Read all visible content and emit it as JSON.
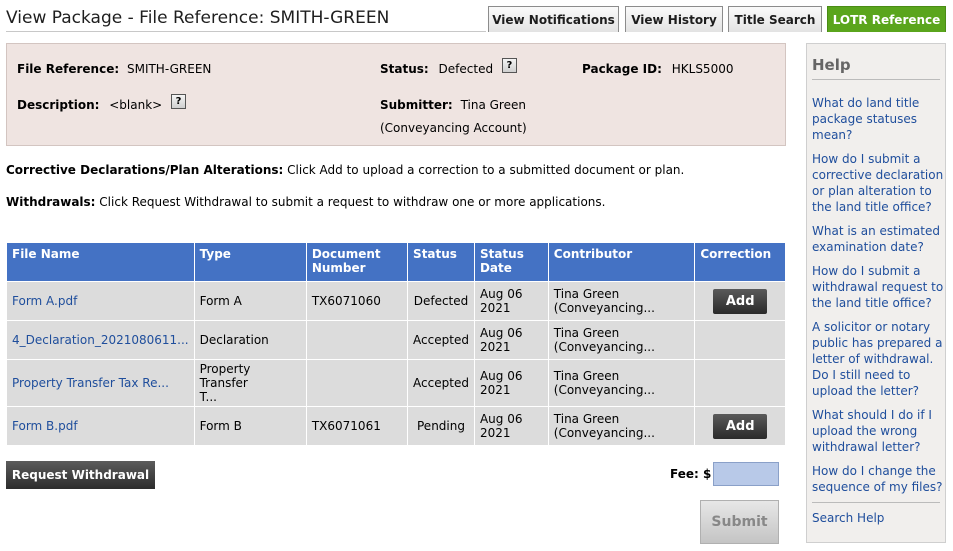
{
  "page": {
    "title": "View Package - File Reference: SMITH-GREEN"
  },
  "tabs": [
    {
      "label": "View Notifications"
    },
    {
      "label": "View History"
    },
    {
      "label": "Title Search"
    },
    {
      "label": "LOTR Reference"
    }
  ],
  "info": {
    "file_ref_label": "File Reference:",
    "file_ref_value": "SMITH-GREEN",
    "status_label": "Status:",
    "status_value": "Defected",
    "package_label": "Package ID:",
    "package_value": "HKLS5000",
    "description_label": "Description:",
    "description_value": "<blank>",
    "submitter_label": "Submitter:",
    "submitter_value": "Tina Green",
    "submitter_account": "(Conveyancing Account)",
    "help_glyph": "?"
  },
  "instructions": {
    "corrective_label": "Corrective Declarations/Plan Alterations:",
    "corrective_text": " Click Add to upload a correction to a submitted document or plan.",
    "withdrawals_label": "Withdrawals:",
    "withdrawals_text": " Click Request Withdrawal to submit a request to withdraw one or more applications."
  },
  "table": {
    "headers": [
      "File Name",
      "Type",
      "Document Number",
      "Status",
      "Status Date",
      "Contributor",
      "Correction"
    ],
    "headers_doc_line2": "Number",
    "rows": [
      {
        "file": "Form A.pdf",
        "type": "Form A",
        "type2": "",
        "doc": "TX6071060",
        "status": "Defected",
        "date": "Aug 06 2021",
        "contrib1": "Tina Green",
        "contrib2": "(Conveyancing...",
        "correction": "Add"
      },
      {
        "file": "4_Declaration_2021080611...",
        "type": "Declaration",
        "type2": "",
        "doc": "",
        "status": "Accepted",
        "date": "Aug 06 2021",
        "contrib1": "Tina Green",
        "contrib2": "(Conveyancing...",
        "correction": ""
      },
      {
        "file": "Property Transfer Tax Re...",
        "type": "Property Transfer",
        "type2": "T...",
        "doc": "",
        "status": "Accepted",
        "date": "Aug 06 2021",
        "contrib1": "Tina Green",
        "contrib2": "(Conveyancing...",
        "correction": ""
      },
      {
        "file": "Form B.pdf",
        "type": "Form B",
        "type2": "",
        "doc": "TX6071061",
        "status": "Pending",
        "date": "Aug 06 2021",
        "contrib1": "Tina Green",
        "contrib2": "(Conveyancing...",
        "correction": "Add"
      }
    ]
  },
  "actions": {
    "request_withdrawal": "Request Withdrawal",
    "fee_label": "Fee: $",
    "fee_value": "",
    "submit": "Submit"
  },
  "help": {
    "title": "Help",
    "links": [
      "What do land title package statuses mean?",
      "How do I submit a corrective declaration or plan alteration to the land title office?",
      "What is an estimated examination date?",
      "How do I submit a withdrawal request to the land title office?",
      "A solicitor or notary public has prepared a letter of withdrawal. Do I still need to upload the letter?",
      "What should I do if I upload the wrong withdrawal letter?",
      "How do I change the sequence of my files?"
    ],
    "search": "Search Help"
  },
  "colors": {
    "tab_accent": "#5aa51c",
    "table_header": "#4472c4",
    "link": "#1f4e9c",
    "info_bg": "#efe4e1"
  }
}
